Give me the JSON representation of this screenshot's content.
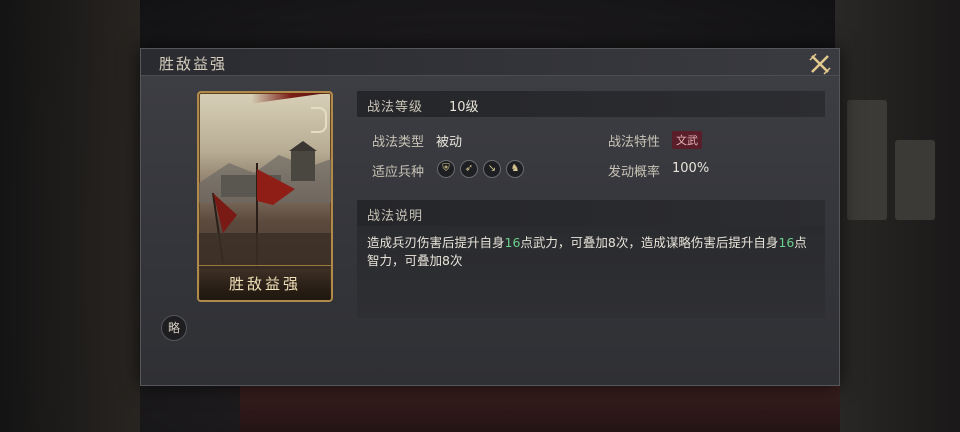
{
  "dialog": {
    "title": "胜敌益强",
    "close_icon": "close-x-icon"
  },
  "card": {
    "name": "胜敌益强"
  },
  "badge": {
    "label": "略"
  },
  "level": {
    "label": "战法等级",
    "value": "10级"
  },
  "info": {
    "type_label": "战法类型",
    "type_value": "被动",
    "trait_label": "战法特性",
    "trait_value": "文武",
    "unit_label": "适应兵种",
    "units": [
      "shield-icon",
      "bow-icon",
      "spear-icon",
      "horse-icon"
    ],
    "rate_label": "发动概率",
    "rate_value": "100%"
  },
  "description": {
    "header": "战法说明",
    "seg1": "造成兵刃伤害后提升自身",
    "num1": "16",
    "seg2": "点武力，可叠加8次，造成谋略伤害后提升自身",
    "num2": "16",
    "seg3": "点智力，可叠加8次"
  },
  "colors": {
    "accent_gold": "#b08a4a",
    "highlight_green": "#6ad08a",
    "tag_bg": "#5a1e2a"
  }
}
